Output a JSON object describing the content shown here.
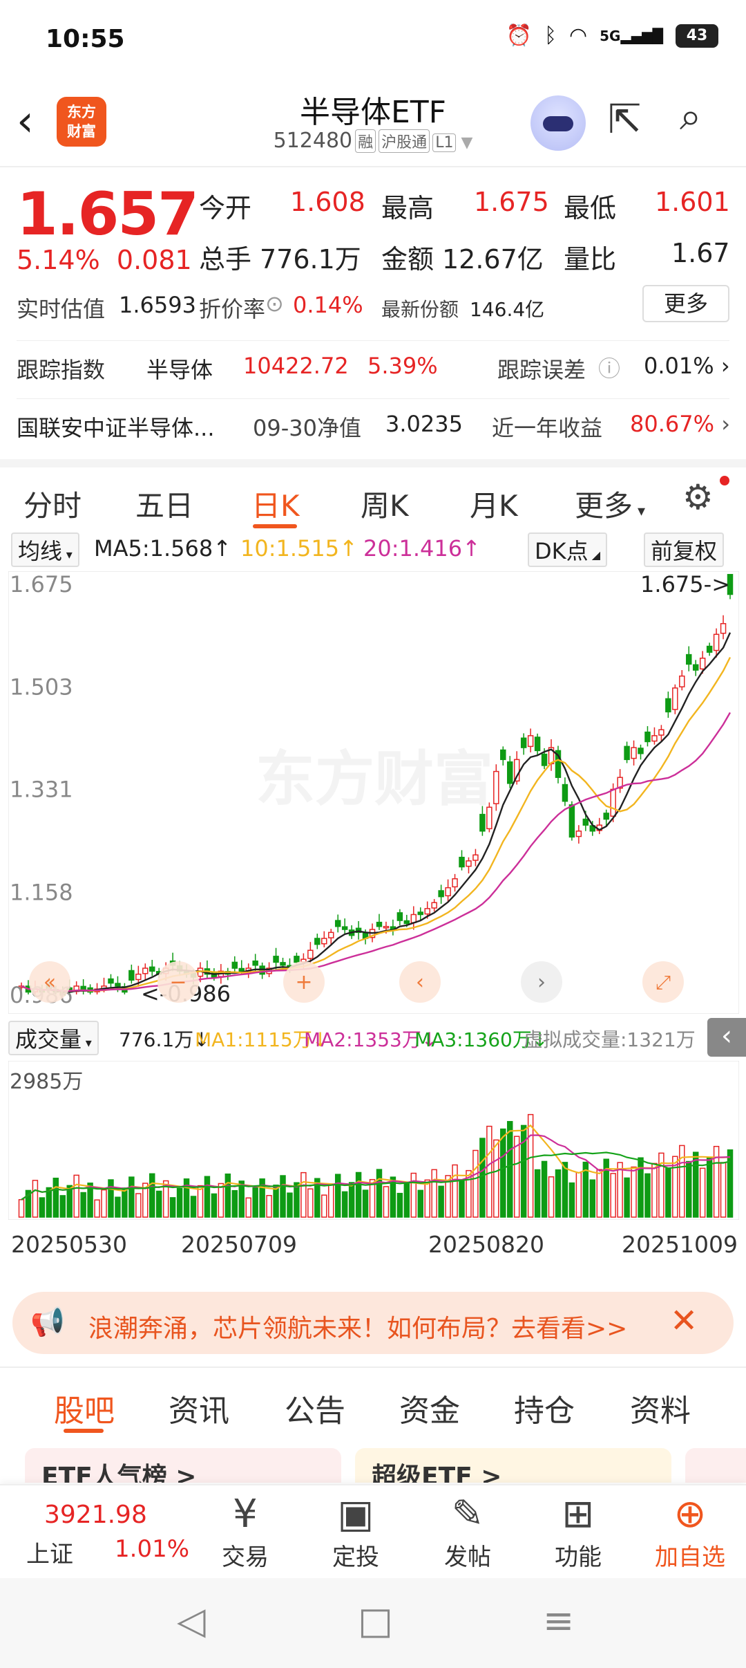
{
  "status": {
    "time": "10:55",
    "signal": "5G",
    "battery": "43"
  },
  "header": {
    "title": "半导体ETF",
    "code": "512480",
    "tags": [
      "融",
      "沪股通",
      "L1"
    ],
    "logo_line1": "东方",
    "logo_line2": "财富"
  },
  "quote": {
    "price": "1.657",
    "change_pct": "5.14%",
    "change_abs": "0.081",
    "open_label": "今开",
    "open": "1.608",
    "high_label": "最高",
    "high": "1.675",
    "low_label": "最低",
    "low": "1.601",
    "volume_label": "总手",
    "volume": "776.1万",
    "amount_label": "金额",
    "amount": "12.67亿",
    "ratio_label": "量比",
    "ratio": "1.67",
    "iopv_label": "实时估值",
    "iopv": "1.6593",
    "premium_label": "折价率",
    "premium": "0.14%",
    "shares_label": "最新份额",
    "shares": "146.4亿",
    "more": "更多"
  },
  "tracking": {
    "label": "跟踪指数",
    "index": "半导体",
    "index_value": "10422.72",
    "index_pct": "5.39%",
    "error_label": "跟踪误差",
    "error": "0.01%"
  },
  "fund": {
    "name": "国联安中证半导体...",
    "nav_label": "09-30净值",
    "nav": "3.0235",
    "yr_label": "近一年收益",
    "yr": "80.67%"
  },
  "tabs": [
    "分时",
    "五日",
    "日K",
    "周K",
    "月K",
    "更多"
  ],
  "ma": {
    "selector": "均线",
    "ma5": "MA5:1.568",
    "ma10": "10:1.515",
    "ma20": "20:1.416",
    "dk": "DK点",
    "adjust": "前复权"
  },
  "chart_data": {
    "type": "candlestick",
    "y_ticks": [
      "1.675",
      "1.503",
      "1.331",
      "1.158",
      "0.986"
    ],
    "ylim": [
      0.986,
      1.675
    ],
    "high_marker": "1.675->",
    "low_marker": "<-0.986",
    "watermark": "东方财富",
    "x_ticks": [
      "20250530",
      "20250709",
      "20250820",
      "20251009"
    ],
    "closes": [
      1.0,
      0.99,
      0.995,
      0.99,
      0.995,
      0.99,
      0.985,
      0.99,
      1.0,
      0.995,
      0.99,
      0.995,
      1.0,
      1.005,
      1.0,
      0.99,
      1.01,
      1.02,
      1.03,
      1.025,
      1.02,
      1.03,
      1.035,
      1.025,
      1.02,
      1.015,
      1.03,
      1.02,
      1.015,
      1.025,
      1.02,
      1.03,
      1.025,
      1.03,
      1.035,
      1.02,
      1.03,
      1.04,
      1.035,
      1.03,
      1.04,
      1.045,
      1.06,
      1.07,
      1.08,
      1.09,
      1.1,
      1.095,
      1.085,
      1.09,
      1.08,
      1.095,
      1.1,
      1.1,
      1.095,
      1.11,
      1.105,
      1.12,
      1.12,
      1.13,
      1.14,
      1.15,
      1.165,
      1.18,
      1.2,
      1.21,
      1.22,
      1.26,
      1.3,
      1.36,
      1.38,
      1.34,
      1.38,
      1.4,
      1.42,
      1.395,
      1.37,
      1.4,
      1.35,
      1.31,
      1.25,
      1.26,
      1.27,
      1.26,
      1.27,
      1.28,
      1.33,
      1.35,
      1.38,
      1.4,
      1.39,
      1.41,
      1.42,
      1.43,
      1.46,
      1.5,
      1.52,
      1.54,
      1.53,
      1.55,
      1.56,
      1.59,
      1.608,
      1.657
    ]
  },
  "volume": {
    "selector": "成交量",
    "value": "776.1万",
    "ma1": "MA1:1115万",
    "ma2": "MA2:1353万",
    "ma3": "MA3:1360万",
    "virtual": "虚拟成交量:1321万",
    "max": "2985万"
  },
  "banner": {
    "text": "浪潮奔涌，芯片领航未来！如何布局？去看看>>"
  },
  "bottom_tabs": [
    "股吧",
    "资讯",
    "公告",
    "资金",
    "持仓",
    "资料"
  ],
  "cards": [
    "ETF人气榜 >",
    "超级ETF >"
  ],
  "toolbar": {
    "index_value": "3921.98",
    "index_name": "上证",
    "index_pct": "1.01%",
    "trade": "交易",
    "invest": "定投",
    "post": "发帖",
    "func": "功能",
    "add": "加自选"
  }
}
